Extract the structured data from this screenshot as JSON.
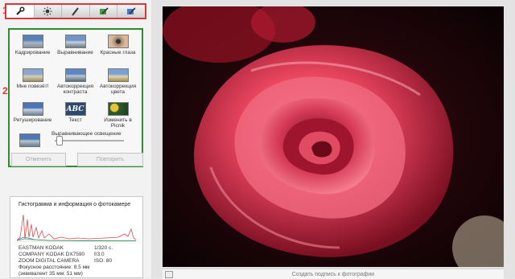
{
  "markers": {
    "one": "1",
    "two": "2"
  },
  "tabs": [
    {
      "icon": "wrench-icon"
    },
    {
      "icon": "sun-icon"
    },
    {
      "icon": "brush-icon"
    },
    {
      "icon": "edit-pencil-icon"
    },
    {
      "icon": "paint-bucket-icon"
    }
  ],
  "tools": [
    {
      "label": "Кадрирование",
      "icon": "crop-icon"
    },
    {
      "label": "Выравнивание",
      "icon": "straighten-icon"
    },
    {
      "label": "Красные глаза",
      "icon": "redeye-icon"
    },
    {
      "label": "Мне повезёт!",
      "icon": "lucky-icon"
    },
    {
      "label": "Автокоррекция\nконтраста",
      "icon": "auto-contrast-icon"
    },
    {
      "label": "Автокоррекция\nцвета",
      "icon": "auto-color-icon"
    },
    {
      "label": "Ретуширование",
      "icon": "retouch-icon"
    },
    {
      "label": "Текст",
      "icon": "text-icon",
      "thumb_text": "ABC"
    },
    {
      "label": "Изменить в Picnik",
      "icon": "picnik-icon"
    }
  ],
  "leveling": {
    "label": "Выравнивающее освещение",
    "value": 0
  },
  "buttons": {
    "undo": "Отменить",
    "redo": "Повторить"
  },
  "histogram": {
    "title": "Гистограмма и информация о фотокамере",
    "camera_lines": [
      "EASTMAN KODAK",
      "COMPANY KODAK DX7590",
      "ZOOM DIGITAL CAMERA",
      "Фокусное расстояние: 8.5 мм",
      "(эквивалент 35 мм:  51 мм)"
    ],
    "exposure_lines": [
      "1/320 с.",
      "f/3.0",
      "ISO: 80"
    ],
    "colors": {
      "red": "#e0484c",
      "blue": "#3b6fd4",
      "green": "#3da64a"
    }
  },
  "photo": {
    "caption": "Создать подпись к фотографии"
  },
  "accent": {
    "annotation_red": "#d8383c",
    "annotation_green": "#2e8b2e"
  }
}
